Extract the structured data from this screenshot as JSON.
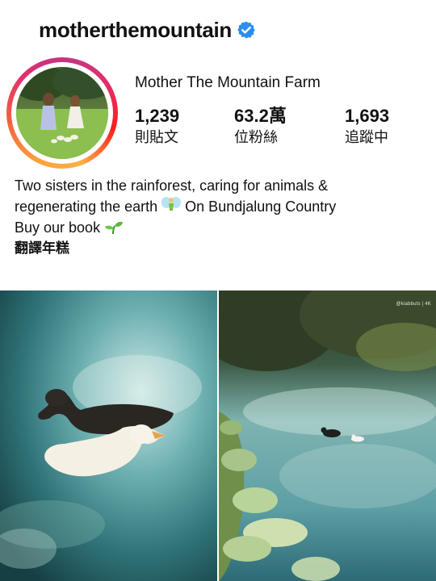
{
  "profile": {
    "username": "motherthemountain",
    "display_name": "Mother The Mountain Farm",
    "verified": true
  },
  "stats": {
    "posts": {
      "value": "1,239",
      "label": "則貼文"
    },
    "followers": {
      "value": "63.2萬",
      "label": "位粉絲"
    },
    "following": {
      "value": "1,693",
      "label": "追蹤中"
    }
  },
  "bio": {
    "line1": "Two sisters in the rainforest, caring for animals &",
    "line2_a": "regenerating the earth",
    "line2_b": "On Bundjalung Country",
    "line3": "Buy our book",
    "translate_label": "翻譯年糕"
  },
  "icons": {
    "verified": "verified-badge-icon",
    "fairy": "fairy-emoji-icon",
    "seedling": "seedling-emoji-icon"
  },
  "colors": {
    "verified_blue": "#2b8ef0",
    "story_ring_start": "#f9a13a",
    "story_ring_end": "#c13584"
  },
  "posts": [
    {
      "id": "post-1",
      "watermark": ""
    },
    {
      "id": "post-2",
      "watermark": "@kiabbuts | 4K"
    }
  ]
}
